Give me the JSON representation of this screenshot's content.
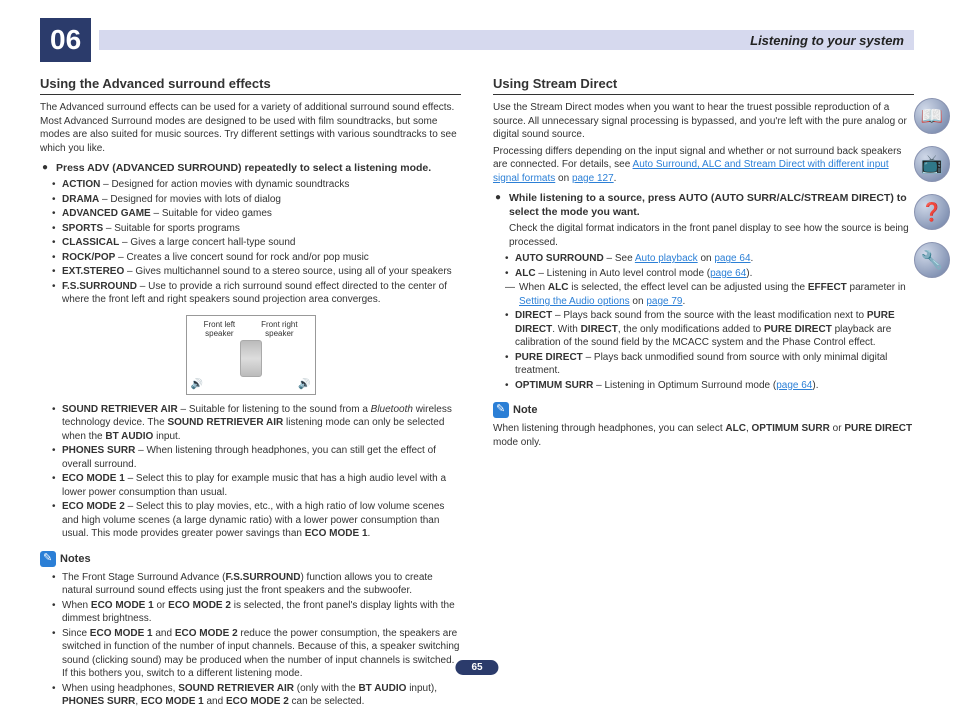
{
  "header": {
    "chapter": "06",
    "title": "Listening to your system"
  },
  "left": {
    "h1": "Using the Advanced surround effects",
    "intro": "The Advanced surround effects can be used for a variety of additional surround sound effects. Most Advanced Surround modes are designed to be used with film soundtracks, but some modes are also suited for music sources. Try different settings with various soundtracks to see which you like.",
    "step1": "Press ADV (ADVANCED SURROUND) repeatedly to select a listening mode.",
    "modes": [
      {
        "name": "ACTION",
        "desc": " – Designed for action movies with dynamic soundtracks"
      },
      {
        "name": "DRAMA",
        "desc": " – Designed for movies with lots of dialog"
      },
      {
        "name": "ADVANCED GAME",
        "desc": " – Suitable for video games"
      },
      {
        "name": "SPORTS",
        "desc": " – Suitable for sports programs"
      },
      {
        "name": "CLASSICAL",
        "desc": " – Gives a large concert hall-type sound"
      },
      {
        "name": "ROCK/POP",
        "desc": " – Creates a live concert sound for rock and/or pop music"
      },
      {
        "name": "EXT.STEREO",
        "desc": " – Gives multichannel sound to a stereo source, using all of your speakers"
      },
      {
        "name": "F.S.SURROUND",
        "desc": " – Use to provide a rich surround sound effect directed to the center of where the front left and right speakers sound projection area converges."
      }
    ],
    "diagram": {
      "fl": "Front left speaker",
      "fr": "Front right speaker"
    },
    "modes2a_name": "SOUND RETRIEVER AIR",
    "modes2a_desc": " – Suitable for listening to the sound from a ",
    "modes2a_em": "Bluetooth",
    "modes2a_desc2": " wireless technology device. The ",
    "modes2a_name2": "SOUND RETRIEVER AIR",
    "modes2a_desc3": " listening mode can only be selected when the ",
    "modes2a_name3": "BT AUDIO",
    "modes2a_desc4": " input.",
    "modes2b_name": "PHONES SURR",
    "modes2b_desc": " – When listening through headphones, you can still get the effect of overall surround.",
    "modes2c_name": "ECO MODE 1",
    "modes2c_desc": " – Select this to play for example music that has a high audio level with a lower power consumption than usual.",
    "modes2d_name": "ECO MODE 2",
    "modes2d_desc": " – Select this to play movies, etc., with a high ratio of low volume scenes and high volume scenes (a large dynamic ratio) with a lower power consumption than usual. This mode provides greater power savings than ",
    "modes2d_name2": "ECO MODE 1",
    "modes2d_desc2": ".",
    "notehdr": "Notes",
    "note1a": "The Front Stage Surround Advance (",
    "note1b": "F.S.SURROUND",
    "note1c": ") function allows you to create natural surround sound effects using just the front speakers and the subwoofer.",
    "note2a": "When ",
    "note2b": "ECO MODE 1",
    "note2c": " or ",
    "note2d": "ECO MODE 2",
    "note2e": " is selected, the front panel's display lights with the dimmest brightness.",
    "note3a": "Since ",
    "note3b": "ECO MODE 1",
    "note3c": " and ",
    "note3d": "ECO MODE 2",
    "note3e": " reduce the power consumption, the speakers are switched in function of the number of input channels. Because of this, a speaker switching sound (clicking sound) may be produced when the number of input channels is switched. If this bothers you, switch to a different listening mode.",
    "note4a": "When using headphones, ",
    "note4b": "SOUND RETRIEVER AIR",
    "note4c": " (only with the ",
    "note4d": "BT AUDIO",
    "note4e": " input), ",
    "note4f": "PHONES SURR",
    "note4g": ", ",
    "note4h": "ECO MODE 1",
    "note4i": " and ",
    "note4j": "ECO MODE 2",
    "note4k": " can be selected."
  },
  "right": {
    "h1": "Using Stream Direct",
    "intro1": "Use the Stream Direct modes when you want to hear the truest possible reproduction of a source. All unnecessary signal processing is bypassed, and you're left with the pure analog or digital sound source.",
    "intro2a": "Processing differs depending on the input signal and whether or not surround back speakers are connected. For details, see ",
    "intro2link": "Auto Surround, ALC and Stream Direct with different input signal formats",
    "intro2b": " on ",
    "intro2pg": "page 127",
    "intro2c": ".",
    "step1": "While listening to a source, press AUTO (AUTO SURR/ALC/STREAM DIRECT) to select the mode you want.",
    "step1sub": "Check the digital format indicators in the front panel display to see how the source is being processed.",
    "m1n": "AUTO SURROUND",
    "m1a": " – See ",
    "m1l": "Auto playback",
    "m1b": " on ",
    "m1p": "page 64",
    "m1c": ".",
    "m2n": "ALC",
    "m2a": " – Listening in Auto level control mode (",
    "m2p": "page 64",
    "m2b": ").",
    "sub1a": "When ",
    "sub1b": "ALC",
    "sub1c": " is selected, the effect level can be adjusted using the ",
    "sub1d": "EFFECT",
    "sub1e": " parameter in ",
    "sub1l": "Setting the Audio options",
    "sub1f": " on ",
    "sub1p": "page 79",
    "sub1g": ".",
    "m3n": "DIRECT",
    "m3a": " – Plays back sound from the source with the least modification next to ",
    "m3b": "PURE DIRECT",
    "m3c": ". With ",
    "m3d": "DIRECT",
    "m3e": ", the only modifications added to ",
    "m3f": "PURE DIRECT",
    "m3g": " playback are calibration of the sound field by the MCACC system and the Phase Control effect.",
    "m4n": "PURE DIRECT",
    "m4a": " – Plays back unmodified sound from source with only minimal digital treatment.",
    "m5n": "OPTIMUM SURR",
    "m5a": " – Listening in Optimum Surround mode (",
    "m5p": "page 64",
    "m5b": ").",
    "notehdr": "Note",
    "note1a": "When listening through headphones, you can select ",
    "note1b": "ALC",
    "note1c": ", ",
    "note1d": "OPTIMUM SURR",
    "note1e": " or ",
    "note1f": "PURE DIRECT",
    "note1g": " mode only."
  },
  "pagenum": "65"
}
